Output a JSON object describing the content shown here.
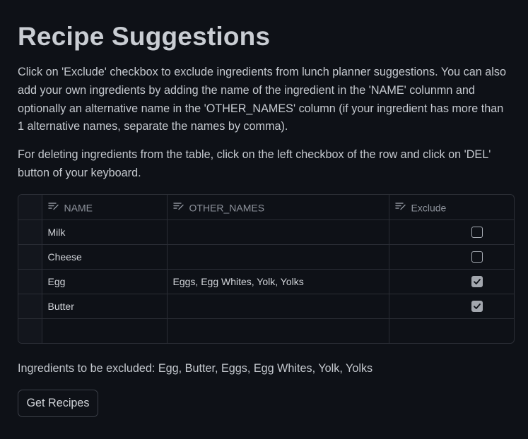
{
  "page": {
    "title": "Recipe Suggestions",
    "paragraph1": "Click on 'Exclude' checkbox to exclude ingredients from lunch planner suggestions. You can also add your own ingredients by adding the name of the ingredient in the 'NAME' colunmn and optionally an alternative name in the 'OTHER_NAMES' column (if your ingredient has more than 1 alternative names, separate the names by comma).",
    "paragraph2": "For deleting ingredients from the table, click on the left checkbox of the row and click on 'DEL' button of your keyboard."
  },
  "table": {
    "header_icon": "edit-text-icon",
    "columns": [
      "NAME",
      "OTHER_NAMES",
      "Exclude"
    ],
    "rows": [
      {
        "name": "Milk",
        "other_names": "",
        "exclude": false
      },
      {
        "name": "Cheese",
        "other_names": "",
        "exclude": false
      },
      {
        "name": "Egg",
        "other_names": "Eggs, Egg Whites, Yolk, Yolks",
        "exclude": true
      },
      {
        "name": "Butter",
        "other_names": "",
        "exclude": true
      }
    ]
  },
  "excluded_text": "Ingredients to be excluded: Egg, Butter, Eggs, Egg Whites, Yolk, Yolks",
  "button": {
    "label": "Get Recipes"
  },
  "colors": {
    "background": "#0e1117",
    "text": "#c9cdd3",
    "border": "#2c2f37",
    "checkbox_checked": "#a3a7ae"
  }
}
